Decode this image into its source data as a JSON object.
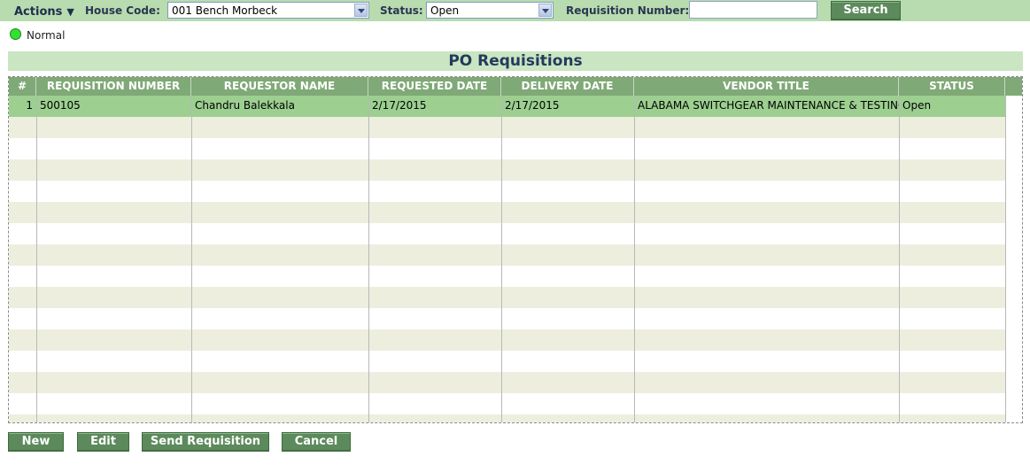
{
  "toolbar": {
    "actions_label": "Actions",
    "house_code_label": "House Code:",
    "house_code_value": "001 Bench Morbeck",
    "status_label": "Status:",
    "status_value": "Open",
    "req_number_label": "Requisition Number:",
    "req_number_value": "",
    "search_label": "Search"
  },
  "legend": {
    "normal_label": "Normal",
    "normal_color": "#2ee52e"
  },
  "page_title": "PO Requisitions",
  "table": {
    "headers": [
      "#",
      "REQUISITION NUMBER",
      "REQUESTOR NAME",
      "REQUESTED DATE",
      "DELIVERY DATE",
      "VENDOR TITLE",
      "STATUS"
    ],
    "rows": [
      [
        "1",
        "500105",
        "Chandru Balekkala",
        "2/17/2015",
        "2/17/2015",
        "ALABAMA SWITCHGEAR MAINTENANCE & TESTING",
        "Open"
      ]
    ]
  },
  "buttons": {
    "new": "New",
    "edit": "Edit",
    "send": "Send Requisition",
    "cancel": "Cancel"
  },
  "colors": {
    "toolbar_bg": "#b8dcb0",
    "header_bg": "#7fa976",
    "selected_row": "#9ccf90",
    "alt_row": "#eeeedf",
    "button_bg": "#5c8a5c"
  }
}
